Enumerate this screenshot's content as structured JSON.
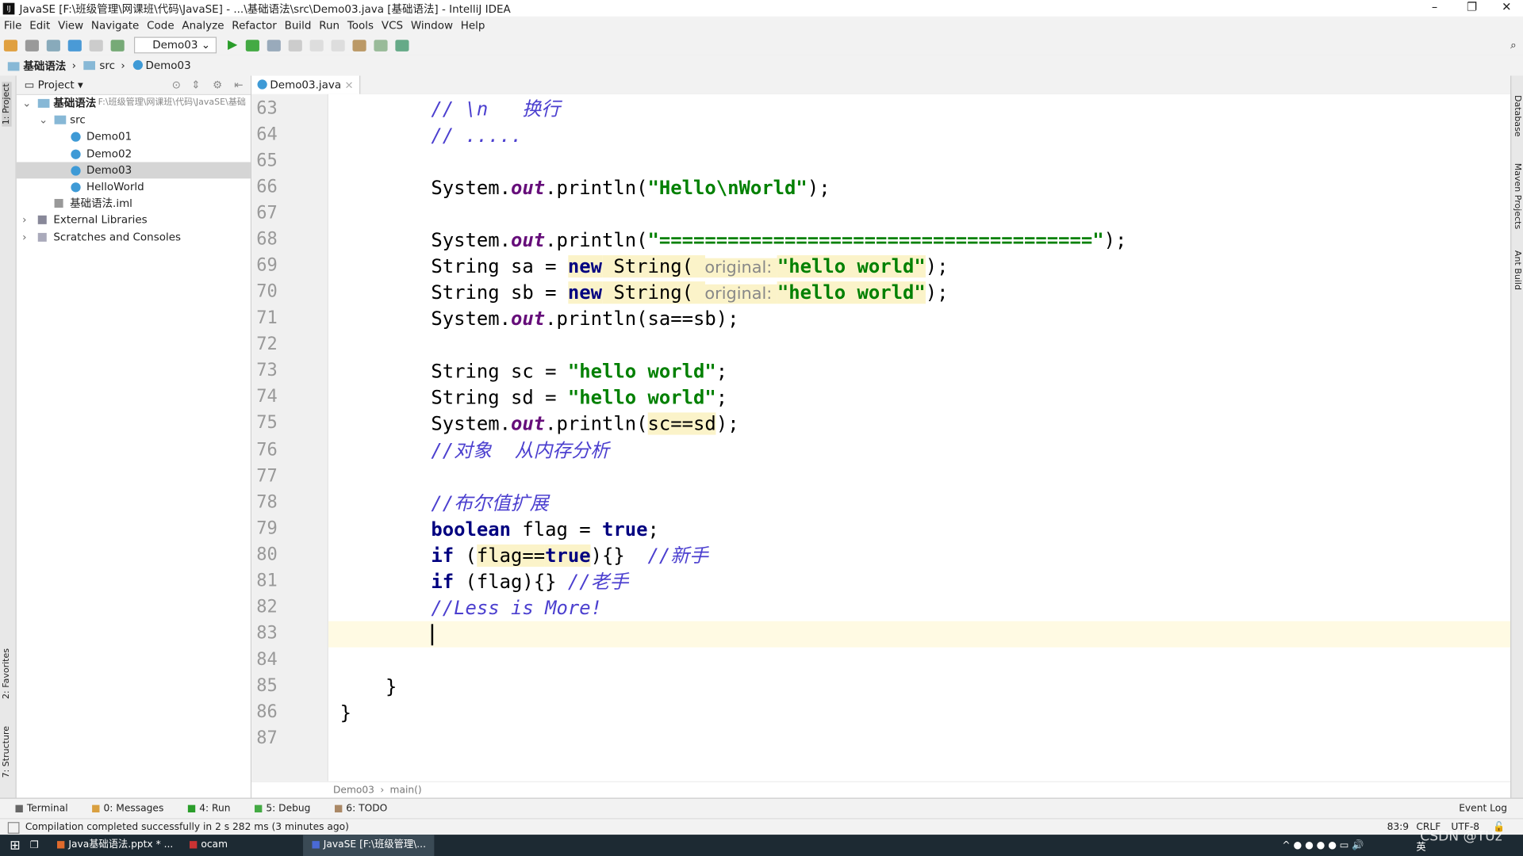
{
  "window": {
    "title": "JavaSE [F:\\班级管理\\网课班\\代码\\JavaSE] - ...\\基础语法\\src\\Demo03.java [基础语法] - IntelliJ IDEA",
    "logo": "IJ"
  },
  "menu": [
    "File",
    "Edit",
    "View",
    "Navigate",
    "Code",
    "Analyze",
    "Refactor",
    "Build",
    "Run",
    "Tools",
    "VCS",
    "Window",
    "Help"
  ],
  "toolbar": {
    "run_config": "Demo03"
  },
  "navbar": [
    "基础语法",
    "src",
    "Demo03"
  ],
  "left_strip": {
    "project": "1: Project",
    "favorites": "2: Favorites",
    "structure": "7: Structure"
  },
  "right_strip": [
    "Database",
    "Maven Projects",
    "Ant Build"
  ],
  "project": {
    "header": "Project",
    "tree": [
      {
        "label": "基础语法",
        "path": "F:\\班级管理\\网课班\\代码\\JavaSE\\基础",
        "type": "module",
        "depth": 0,
        "expanded": true
      },
      {
        "label": "src",
        "type": "folder",
        "depth": 1,
        "expanded": true
      },
      {
        "label": "Demo01",
        "type": "class",
        "depth": 2
      },
      {
        "label": "Demo02",
        "type": "class",
        "depth": 2
      },
      {
        "label": "Demo03",
        "type": "class",
        "depth": 2,
        "selected": true
      },
      {
        "label": "HelloWorld",
        "type": "class",
        "depth": 2
      },
      {
        "label": "基础语法.iml",
        "type": "file",
        "depth": 1
      },
      {
        "label": "External Libraries",
        "type": "lib",
        "depth": 0,
        "expanded": false
      },
      {
        "label": "Scratches and Consoles",
        "type": "scratch",
        "depth": 0,
        "expanded": false
      }
    ]
  },
  "editor": {
    "tab": "Demo03.java",
    "current_line": 83,
    "lines": [
      {
        "n": 63,
        "indent": 8,
        "tokens": [
          {
            "t": "// \\n   换行",
            "c": "c"
          }
        ]
      },
      {
        "n": 64,
        "indent": 8,
        "tokens": [
          {
            "t": "// .....",
            "c": "c"
          }
        ]
      },
      {
        "n": 65,
        "indent": 0,
        "tokens": []
      },
      {
        "n": 66,
        "indent": 8,
        "tokens": [
          {
            "t": "System.",
            "c": "p"
          },
          {
            "t": "out",
            "c": "f"
          },
          {
            "t": ".println(",
            "c": "p"
          },
          {
            "t": "\"Hello\\nWorld\"",
            "c": "s"
          },
          {
            "t": ");",
            "c": "p"
          }
        ]
      },
      {
        "n": 67,
        "indent": 0,
        "tokens": []
      },
      {
        "n": 68,
        "indent": 8,
        "tokens": [
          {
            "t": "System.",
            "c": "p"
          },
          {
            "t": "out",
            "c": "f"
          },
          {
            "t": ".println(",
            "c": "p"
          },
          {
            "t": "\"======================================\"",
            "c": "s"
          },
          {
            "t": ");",
            "c": "p"
          }
        ]
      },
      {
        "n": 69,
        "indent": 8,
        "tokens": [
          {
            "t": "String sa = ",
            "c": "p"
          },
          {
            "t": "new",
            "c": "k hl"
          },
          {
            "t": " String( ",
            "c": "p hl"
          },
          {
            "t": "original: ",
            "c": "h hl"
          },
          {
            "t": "\"hello world\"",
            "c": "s hl"
          },
          {
            "t": ");",
            "c": "p"
          }
        ]
      },
      {
        "n": 70,
        "indent": 8,
        "tokens": [
          {
            "t": "String sb = ",
            "c": "p"
          },
          {
            "t": "new",
            "c": "k hl"
          },
          {
            "t": " String( ",
            "c": "p hl"
          },
          {
            "t": "original: ",
            "c": "h hl"
          },
          {
            "t": "\"hello world\"",
            "c": "s hl"
          },
          {
            "t": ");",
            "c": "p"
          }
        ]
      },
      {
        "n": 71,
        "indent": 8,
        "tokens": [
          {
            "t": "System.",
            "c": "p"
          },
          {
            "t": "out",
            "c": "f"
          },
          {
            "t": ".println(sa==sb);",
            "c": "p"
          }
        ]
      },
      {
        "n": 72,
        "indent": 0,
        "tokens": []
      },
      {
        "n": 73,
        "indent": 8,
        "tokens": [
          {
            "t": "String sc = ",
            "c": "p"
          },
          {
            "t": "\"hello world\"",
            "c": "s"
          },
          {
            "t": ";",
            "c": "p"
          }
        ]
      },
      {
        "n": 74,
        "indent": 8,
        "tokens": [
          {
            "t": "String sd = ",
            "c": "p"
          },
          {
            "t": "\"hello world\"",
            "c": "s"
          },
          {
            "t": ";",
            "c": "p"
          }
        ]
      },
      {
        "n": 75,
        "indent": 8,
        "tokens": [
          {
            "t": "System.",
            "c": "p"
          },
          {
            "t": "out",
            "c": "f"
          },
          {
            "t": ".println(",
            "c": "p"
          },
          {
            "t": "sc==sd",
            "c": "p hl"
          },
          {
            "t": ");",
            "c": "p"
          }
        ]
      },
      {
        "n": 76,
        "indent": 8,
        "tokens": [
          {
            "t": "//对象  从内存分析",
            "c": "c"
          }
        ]
      },
      {
        "n": 77,
        "indent": 0,
        "tokens": []
      },
      {
        "n": 78,
        "indent": 8,
        "tokens": [
          {
            "t": "//布尔值扩展",
            "c": "c"
          }
        ]
      },
      {
        "n": 79,
        "indent": 8,
        "tokens": [
          {
            "t": "boolean",
            "c": "k"
          },
          {
            "t": " flag = ",
            "c": "p"
          },
          {
            "t": "true",
            "c": "k"
          },
          {
            "t": ";",
            "c": "p"
          }
        ]
      },
      {
        "n": 80,
        "indent": 8,
        "tokens": [
          {
            "t": "if",
            "c": "k"
          },
          {
            "t": " (",
            "c": "p"
          },
          {
            "t": "flag==",
            "c": "p hl"
          },
          {
            "t": "true",
            "c": "k hl"
          },
          {
            "t": "){}  ",
            "c": "p"
          },
          {
            "t": "//新手",
            "c": "c"
          }
        ]
      },
      {
        "n": 81,
        "indent": 8,
        "tokens": [
          {
            "t": "if",
            "c": "k"
          },
          {
            "t": " (flag){} ",
            "c": "p"
          },
          {
            "t": "//老手",
            "c": "c"
          }
        ]
      },
      {
        "n": 82,
        "indent": 8,
        "tokens": [
          {
            "t": "//Less is More!",
            "c": "c"
          }
        ]
      },
      {
        "n": 83,
        "indent": 8,
        "tokens": []
      },
      {
        "n": 84,
        "indent": 0,
        "tokens": []
      },
      {
        "n": 85,
        "indent": 4,
        "tokens": [
          {
            "t": "}",
            "c": "p"
          }
        ]
      },
      {
        "n": 86,
        "indent": 0,
        "tokens": [
          {
            "t": "}",
            "c": "p"
          }
        ]
      },
      {
        "n": 87,
        "indent": 0,
        "tokens": []
      }
    ],
    "breadcrumb": [
      "Demo03",
      "main()"
    ]
  },
  "tool_tabs": [
    "Terminal",
    "0: Messages",
    "4: Run",
    "5: Debug",
    "6: TODO"
  ],
  "event_log": "Event Log",
  "status": {
    "message": "Compilation completed successfully in 2 s 282 ms (3 minutes ago)",
    "position": "83:9",
    "line_sep": "CRLF",
    "encoding": "UTF-8"
  },
  "taskbar": {
    "items": [
      "Java基础语法.pptx * ...",
      "ocam",
      "JavaSE [F:\\班级管理\\..."
    ],
    "ime": "英",
    "watermark": "CSDN @TUz"
  }
}
